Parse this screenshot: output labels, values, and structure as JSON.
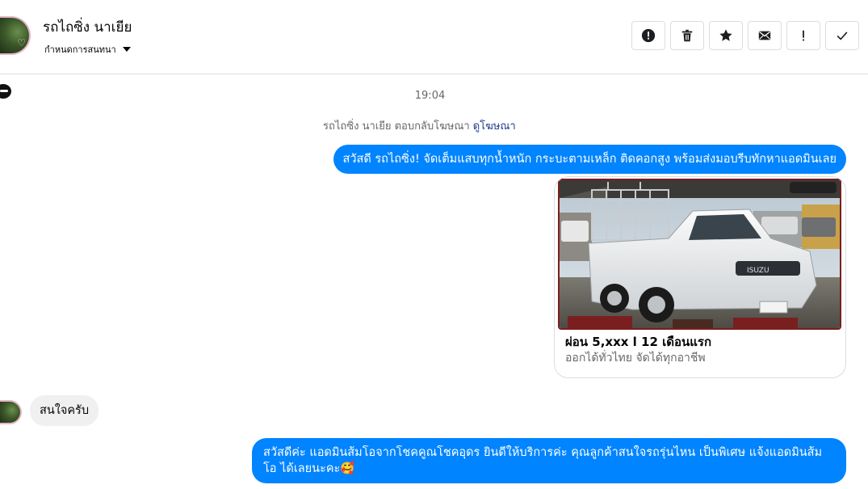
{
  "header": {
    "title": "รถไถซิ่ง นาเยีย",
    "subtitle": "กำหนดการสนทนา",
    "toolbar": [
      "report-icon",
      "trash-icon",
      "star-icon",
      "mail-icon",
      "important-icon",
      "check-icon"
    ]
  },
  "conversation": {
    "timestamp": "19:04",
    "ad_note": {
      "text": "รถไถซิ่ง นาเยีย ตอบกลับโฆษณา",
      "link": "ดูโฆษณา"
    },
    "messages": [
      {
        "from": "page",
        "text": "สวัสดี รถไถซิ่ง! จัดเต็มแสบทุกน้ำหนัก กระบะตามเหล็ก ติดคอกสูง พร้อมส่งมอบรีบทักหาแอดมินเลย"
      },
      {
        "from": "user",
        "text": "สนใจครับ"
      },
      {
        "from": "page",
        "text": "สวัสดีค่ะ แอดมินส้มโอจากโชคคูณโชคอุดร ยินดีให้บริการค่ะ   คุณลูกค้าสนใจรถรุ่นไหน เป็นพิเศษ แจ้งแอดมินส้มโอ ได้เลยนะคะ🥰"
      }
    ],
    "ad_card": {
      "title": "ผ่อน 5,xxx l 12 เดือนแรก",
      "subtitle": "ออกได้ทั่วไทย จัดได้ทุกอาชีพ",
      "brand_text": "ISUZU"
    }
  },
  "colors": {
    "accent": "#0084ff",
    "muted_text": "#65676b",
    "link": "#1f3b8a",
    "incoming_bubble": "#f0f0f0"
  }
}
